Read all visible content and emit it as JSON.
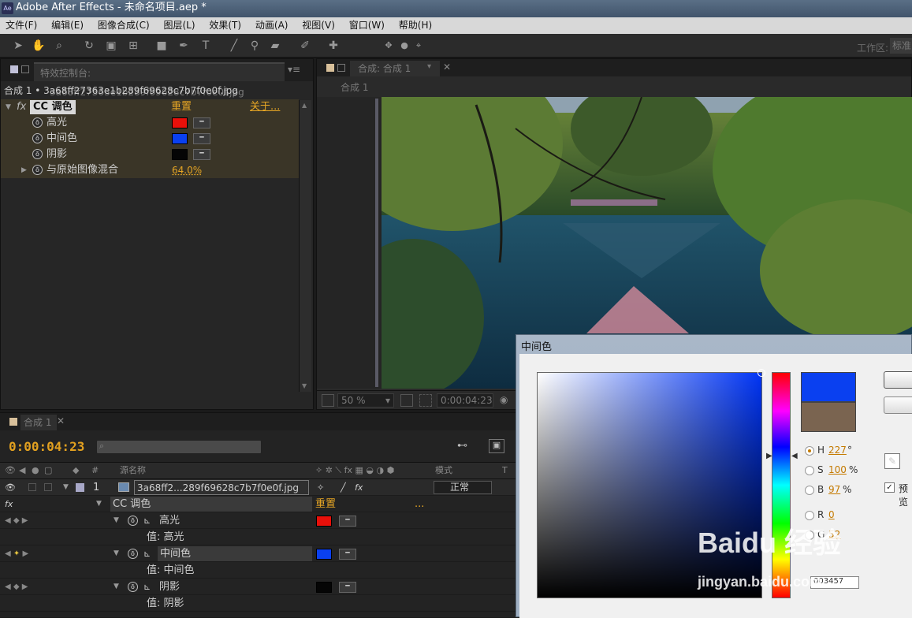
{
  "window": {
    "title": "Adobe After Effects - 未命名项目.aep *"
  },
  "menu": [
    "文件(F)",
    "编辑(E)",
    "图像合成(C)",
    "图层(L)",
    "效果(T)",
    "动画(A)",
    "视图(V)",
    "窗口(W)",
    "帮助(H)"
  ],
  "toolbar": {
    "workspace_label": "工作区:",
    "workspace_value": "标准"
  },
  "effect_controls": {
    "tab_label": "特效控制台: 3a68ff27363e1b289f69628c7b7f0e0f.jpg",
    "subheader": "合成 1 • 3a68ff27363e1b289f69628c7b7f0e0f.jpg",
    "effect_name": "CC 调色",
    "reset_label": "重置",
    "about_label": "关于...",
    "fx_label": "fx",
    "params": [
      {
        "label": "高光",
        "color": "#e8100a"
      },
      {
        "label": "中间色",
        "color": "#0a40f0"
      },
      {
        "label": "阴影",
        "color": "#050505"
      },
      {
        "label": "与原始图像混合",
        "value": "64.0%"
      }
    ]
  },
  "composition": {
    "tab_label": "合成: 合成 1",
    "breadcrumb": "合成 1",
    "zoom": "50 %",
    "timecode": "0:00:04:23"
  },
  "timeline": {
    "tab_label": "合成 1",
    "timecode": "0:00:04:23",
    "headers": {
      "num": "#",
      "source": "源名称",
      "mode": "模式",
      "t": "T"
    },
    "layer": {
      "num": "1",
      "name": "3a68ff2...289f69628c7b7f0e0f.jpg",
      "mode": "正常"
    },
    "effect": {
      "fx": "fx",
      "name": "CC 调色",
      "reset": "重置",
      "about": "..."
    },
    "props": [
      {
        "label": "高光",
        "value_label": "值: 高光",
        "color": "#e8100a"
      },
      {
        "label": "中间色",
        "value_label": "值: 中间色",
        "color": "#0a40f0"
      },
      {
        "label": "阴影",
        "value_label": "值: 阴影",
        "color": "#050505"
      }
    ]
  },
  "color_picker": {
    "title": "中间色",
    "new_color": "#0a40f0",
    "old_color": "#7a6450",
    "fields": [
      {
        "label": "H",
        "value": "227",
        "unit": "°"
      },
      {
        "label": "S",
        "value": "100",
        "unit": "%"
      },
      {
        "label": "B",
        "value": "97",
        "unit": "%"
      },
      {
        "label": "R",
        "value": "0",
        "unit": ""
      },
      {
        "label": "G",
        "value": "52",
        "unit": ""
      }
    ],
    "hex": "003457",
    "preview_label": "预览"
  },
  "watermark": {
    "brand": "Baidu 经验",
    "url": "jingyan.baidu.com"
  }
}
